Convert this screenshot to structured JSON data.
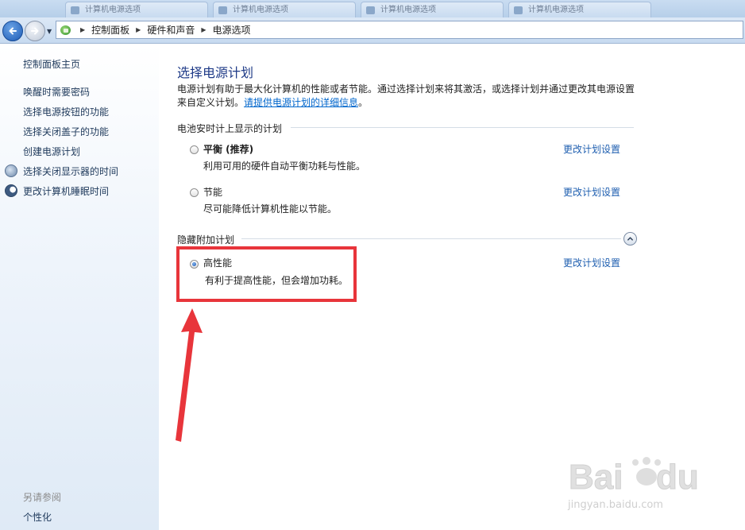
{
  "tabs": [
    {
      "label": "计算机电源选项"
    },
    {
      "label": "计算机电源选项"
    },
    {
      "label": "计算机电源选项"
    },
    {
      "label": "计算机电源选项"
    }
  ],
  "breadcrumb": {
    "items": [
      "控制面板",
      "硬件和声音",
      "电源选项"
    ]
  },
  "sidebar": {
    "home": "控制面板主页",
    "links": [
      {
        "label": "唤醒时需要密码"
      },
      {
        "label": "选择电源按钮的功能"
      },
      {
        "label": "选择关闭盖子的功能"
      },
      {
        "label": "创建电源计划"
      },
      {
        "label": "选择关闭显示器的时间",
        "icon": "display-icon"
      },
      {
        "label": "更改计算机睡眠时间",
        "icon": "moon-icon"
      }
    ],
    "see_also": "另请参阅",
    "personalize": "个性化"
  },
  "main": {
    "title": "选择电源计划",
    "description": "电源计划有助于最大化计算机的性能或者节能。通过选择计划来将其激活，或选择计划并通过更改其电源设置来自定义计划。",
    "more_info_link": "请提供电源计划的详细信息",
    "more_info_suffix": "。",
    "group_battery": "电池安时计上显示的计划",
    "group_hidden": "隐藏附加计划",
    "plans": [
      {
        "name": "平衡 (推荐)",
        "desc": "利用可用的硬件自动平衡功耗与性能。",
        "link": "更改计划设置",
        "selected": false
      },
      {
        "name": "节能",
        "desc": "尽可能降低计算机性能以节能。",
        "link": "更改计划设置",
        "selected": false
      },
      {
        "name": "高性能",
        "desc": "有利于提高性能，但会增加功耗。",
        "link": "更改计划设置",
        "selected": true
      }
    ]
  },
  "watermark": {
    "text": "jingyan.baidu.com"
  },
  "colors": {
    "highlight": "#e8353b",
    "link": "#1f5fb0",
    "title": "#1e3a87"
  }
}
